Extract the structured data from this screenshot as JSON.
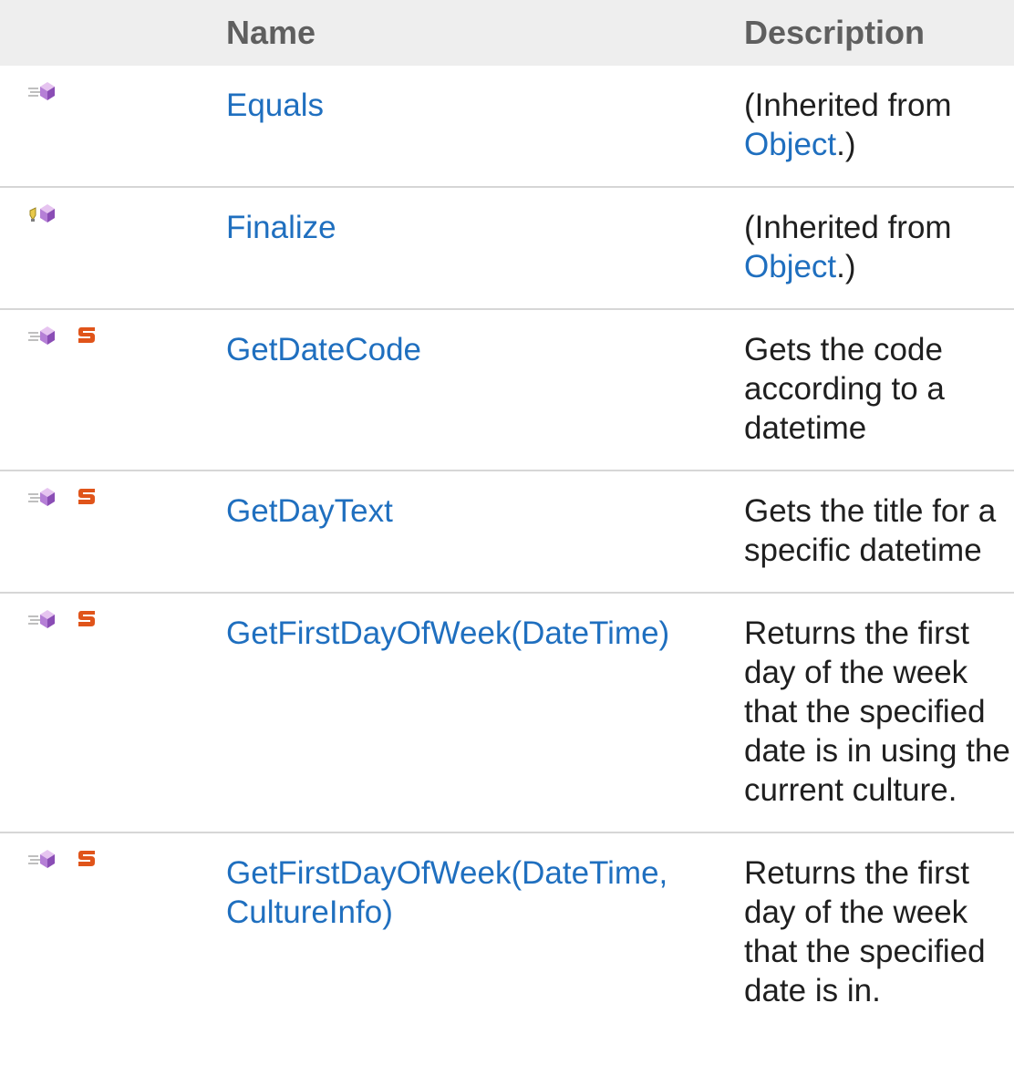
{
  "table": {
    "headers": {
      "icon": "",
      "name": "Name",
      "description": "Description"
    },
    "rows": [
      {
        "icons": [
          "public-method-icon"
        ],
        "name": "Equals",
        "description_inherited_prefix": "(Inherited from ",
        "description_link": "Object",
        "description_suffix": ".)",
        "description": ""
      },
      {
        "icons": [
          "protected-method-icon"
        ],
        "name": "Finalize",
        "description_inherited_prefix": "(Inherited from ",
        "description_link": "Object",
        "description_suffix": ".)",
        "description": ""
      },
      {
        "icons": [
          "public-method-icon",
          "static-icon"
        ],
        "name": "GetDateCode",
        "description": "Gets the code according to a datetime"
      },
      {
        "icons": [
          "public-method-icon",
          "static-icon"
        ],
        "name": "GetDayText",
        "description": "Gets the title for a specific datetime"
      },
      {
        "icons": [
          "public-method-icon",
          "static-icon"
        ],
        "name": "GetFirstDayOfWeek(DateTime)",
        "description": "Returns the first day of the week that the specified date is in using the current culture."
      },
      {
        "icons": [
          "public-method-icon",
          "static-icon"
        ],
        "name": "GetFirstDayOfWeek(DateTime, CultureInfo)",
        "description": "Returns the first day of the week that the specified date is in."
      }
    ]
  },
  "colors": {
    "link": "#1f6fbf",
    "header_bg": "#eeeeee",
    "header_text": "#5f5f5f",
    "row_divider": "#d6d6d6",
    "method_icon": "#b57fd6",
    "static_icon": "#e0541a"
  }
}
